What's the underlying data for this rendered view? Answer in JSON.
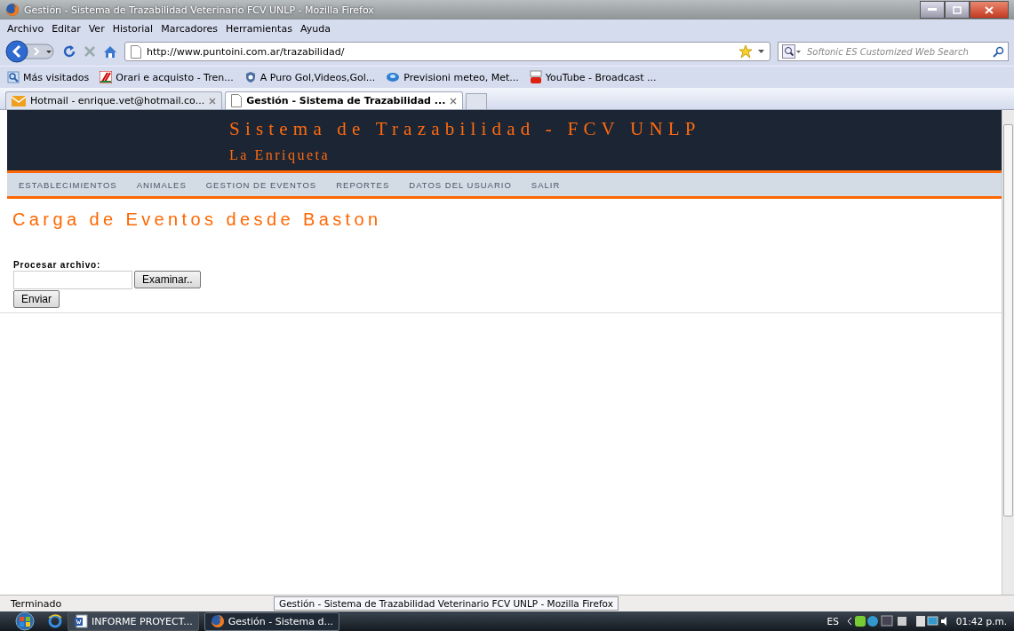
{
  "window": {
    "title": "Gestión - Sistema de Trazabilidad Veterinario FCV UNLP - Mozilla Firefox"
  },
  "menu": [
    {
      "label": "Archivo"
    },
    {
      "label": "Editar"
    },
    {
      "label": "Ver"
    },
    {
      "label": "Historial"
    },
    {
      "label": "Marcadores"
    },
    {
      "label": "Herramientas"
    },
    {
      "label": "Ayuda"
    }
  ],
  "address": {
    "value": "http://www.puntoini.com.ar/trazabilidad/"
  },
  "search": {
    "placeholder": "Softonic ES Customized Web Search"
  },
  "bookmarks": [
    {
      "label": "Más visitados"
    },
    {
      "label": "Orari e acquisto - Tren..."
    },
    {
      "label": "A Puro Gol,Videos,Gol..."
    },
    {
      "label": "Previsioni meteo, Met..."
    },
    {
      "label": "YouTube - Broadcast ..."
    }
  ],
  "tabs": [
    {
      "label": "Hotmail - enrique.vet@hotmail.co...",
      "selected": false
    },
    {
      "label": "Gestión - Sistema de Trazabilidad ...",
      "selected": true
    }
  ],
  "page": {
    "site_title": "Sistema de Trazabilidad - FCV UNLP",
    "site_subtitle": "La Enriqueta",
    "nav": [
      {
        "label": "ESTABLECIMIENTOS"
      },
      {
        "label": "ANIMALES"
      },
      {
        "label": "GESTION DE EVENTOS"
      },
      {
        "label": "REPORTES"
      },
      {
        "label": "DATOS DEL USUARIO"
      },
      {
        "label": "SALIR"
      }
    ],
    "heading": "Carga de Eventos desde Baston",
    "form": {
      "label": "Procesar archivo:",
      "browse_button": "Examinar..",
      "submit_button": "Enviar"
    }
  },
  "status_bar": {
    "text": "Terminado",
    "tooltip": "Gestión - Sistema de Trazabilidad Veterinario FCV UNLP - Mozilla Firefox"
  },
  "taskbar": {
    "items": [
      {
        "label": "INFORME PROYECT...",
        "selected": false
      },
      {
        "label": "Gestión - Sistema d...",
        "selected": true
      }
    ],
    "language": "ES",
    "clock": "01:42 p.m."
  }
}
